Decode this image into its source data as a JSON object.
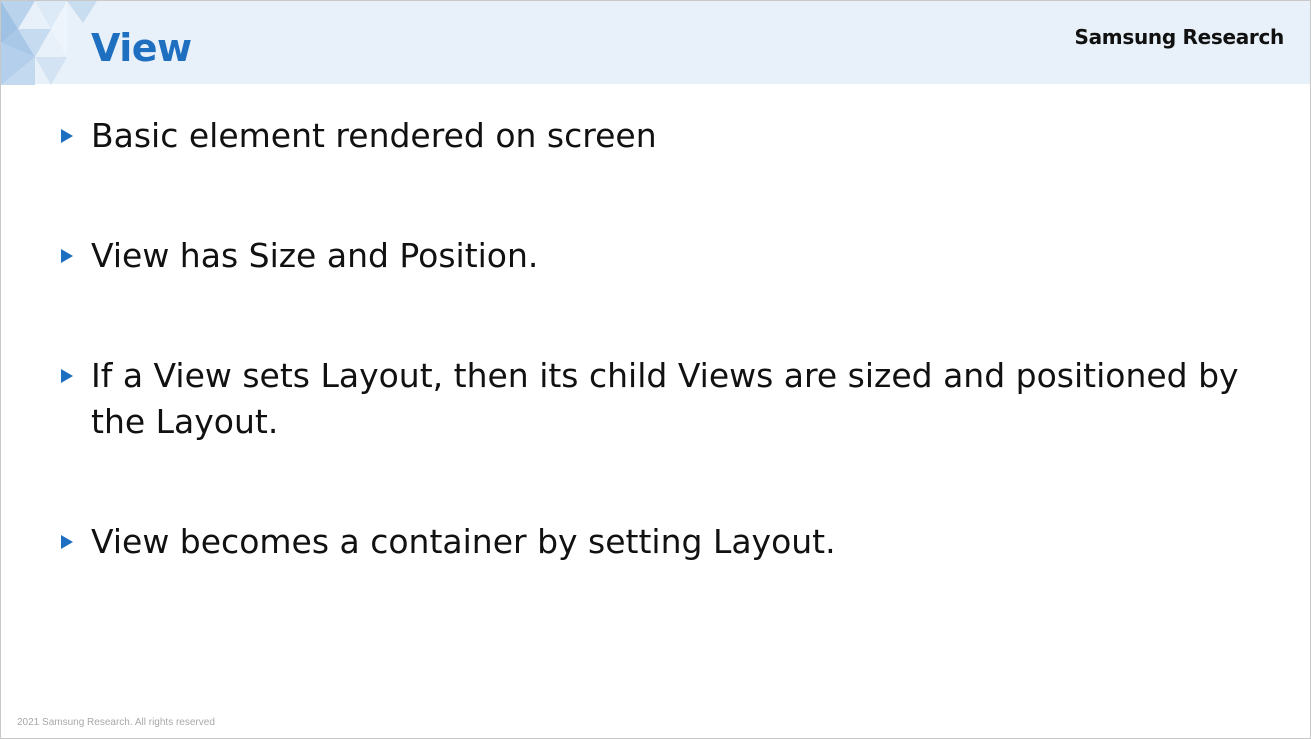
{
  "slide": {
    "title": "View",
    "brand": "Samsung Research",
    "bullets": [
      {
        "text": "Basic element rendered on screen"
      },
      {
        "text": "View has Size and Position."
      },
      {
        "text": "If a View sets Layout, then its child Views are sized and positioned by the Layout."
      },
      {
        "text": "View becomes a container by setting Layout."
      }
    ],
    "footer": "2021 Samsung Research. All rights reserved"
  },
  "colors": {
    "accent": "#1f6fc1",
    "header_background": "#e8f1fa",
    "text": "#111111",
    "footer_text": "#a8a8a8"
  },
  "icons": {
    "bullet": "triangle-right-icon",
    "header_decoration": "triangle-pattern-decoration"
  }
}
